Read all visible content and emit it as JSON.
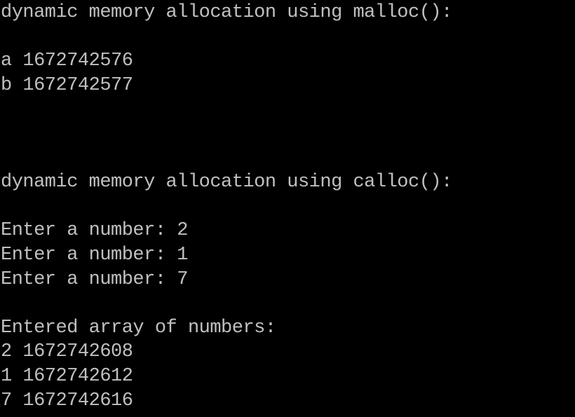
{
  "terminal": {
    "lines": [
      "dynamic memory allocation using malloc():",
      "",
      "a 1672742576",
      "b 1672742577",
      "",
      "",
      "",
      "dynamic memory allocation using calloc():",
      "",
      "Enter a number: 2",
      "Enter a number: 1",
      "Enter a number: 7",
      "",
      "Entered array of numbers:",
      "2 1672742608",
      "1 1672742612",
      "7 1672742616"
    ],
    "colors": {
      "background": "#000000",
      "text": "#c0c0c0"
    }
  }
}
